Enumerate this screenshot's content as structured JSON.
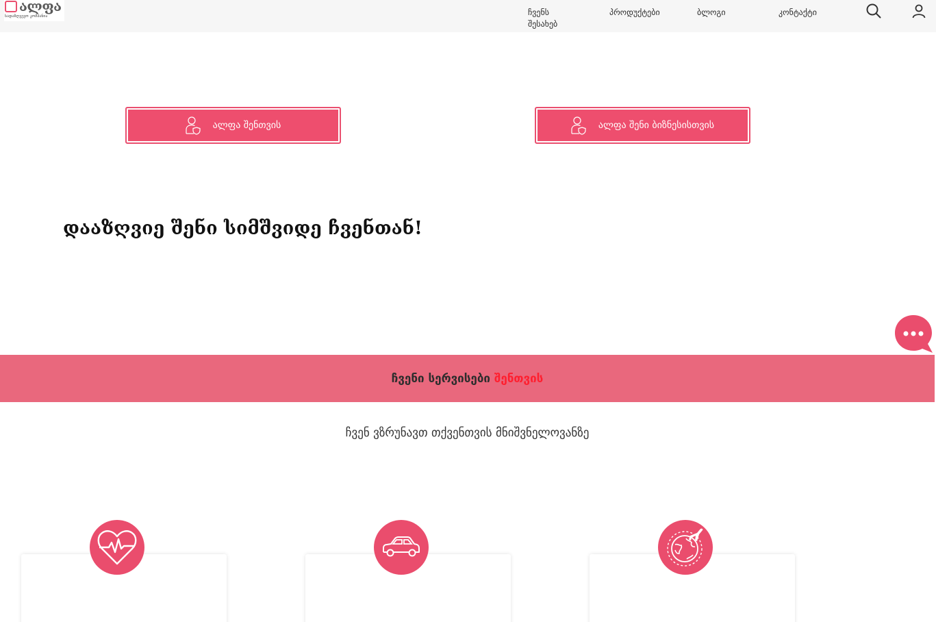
{
  "logo": {
    "name": "ალფა",
    "tagline": "სადაზღვევო კომპანია"
  },
  "nav": {
    "about": "ჩვენს შესახებ",
    "products": "პროდუქტები",
    "blog": "ბლოგი",
    "contact": "კონტაქტი"
  },
  "hero": {
    "cta_personal": "ალფა შენთვის",
    "cta_business": "ალფა შენი ბიზნესისთვის",
    "headline": "დააზღვიე შენი სიმშვიდე ჩვენთან!"
  },
  "services": {
    "title_prefix": "ჩვენი სერვისები",
    "title_accent": "შენთვის",
    "subtitle": "ჩვენ ვზრუნავთ თქვენთვის მნიშვნელოვანზე"
  },
  "cards": [
    {
      "icon": "heart-pulse-icon"
    },
    {
      "icon": "car-icon"
    },
    {
      "icon": "travel-globe-icon"
    }
  ],
  "colors": {
    "brand": "#ee4e6e",
    "band": "#e9687d",
    "accent_text": "#ff1f2f"
  }
}
